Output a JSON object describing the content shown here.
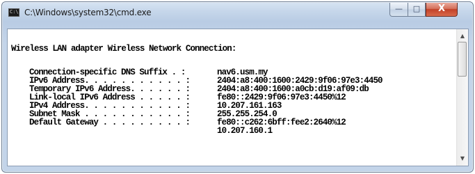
{
  "window": {
    "title": "C:\\Windows\\system32\\cmd.exe",
    "icon_text": "C:\\",
    "controls": {
      "minimize": "—",
      "maximize": "□",
      "close": "X"
    }
  },
  "console": {
    "heading": "Wireless LAN adapter Wireless Network Connection:",
    "rows": [
      {
        "label": "Connection-specific DNS Suffix  . :",
        "value": "nav6.usm.my"
      },
      {
        "label": "IPv6 Address. . . . . . . . . . . :",
        "value": "2404:a8:400:1600:2429:9f06:97e3:4450"
      },
      {
        "label": "Temporary IPv6 Address. . . . . . :",
        "value": "2404:a8:400:1600:a0cb:d19:af09:db"
      },
      {
        "label": "Link-local IPv6 Address . . . . . :",
        "value": "fe80::2429:9f06:97e3:4450%12"
      },
      {
        "label": "IPv4 Address. . . . . . . . . . . :",
        "value": "10.207.161.163"
      },
      {
        "label": "Subnet Mask . . . . . . . . . . . :",
        "value": "255.255.254.0"
      },
      {
        "label": "Default Gateway . . . . . . . . . :",
        "value": "fe80::c262:6bff:fee2:2640%12"
      },
      {
        "label": "",
        "value": "10.207.160.1"
      }
    ]
  },
  "scrollbar": {
    "up_arrow": "▲",
    "down_arrow": "▼"
  }
}
